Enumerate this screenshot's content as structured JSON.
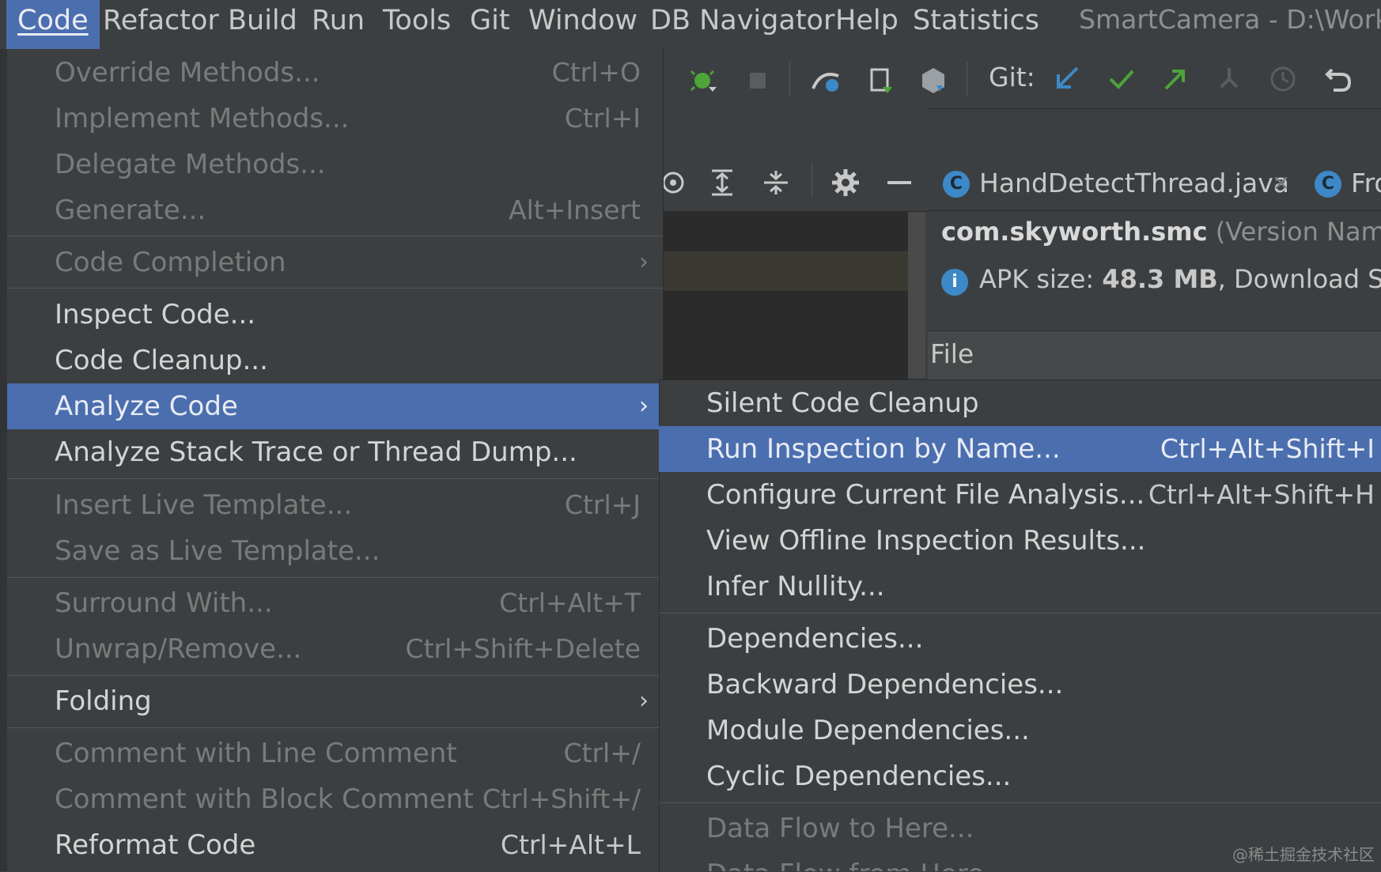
{
  "menubar": {
    "items": [
      "Code",
      "Refactor",
      "Build",
      "Run",
      "Tools",
      "Git",
      "Window",
      "DB Navigator",
      "Help",
      "Statistics"
    ],
    "active": "Code",
    "window_title": "SmartCamera - D:\\Works"
  },
  "toolbar": {
    "git_label": "Git:"
  },
  "editor": {
    "tabs": [
      {
        "icon": "C",
        "label": "HandDetectThread.java",
        "close": "×"
      },
      {
        "icon": "C",
        "label": "Fro"
      }
    ],
    "package_name": "com.skyworth.smc",
    "version_label": "(Version Name:",
    "apk_info_prefix": "APK size:",
    "apk_size": "48.3 MB",
    "apk_info_suffix": ", Download Siz",
    "file_column": "File",
    "info_icon": "i"
  },
  "code_menu": {
    "items": [
      {
        "label": "Override Methods...",
        "shortcut": "Ctrl+O",
        "enabled": false
      },
      {
        "label": "Implement Methods...",
        "shortcut": "Ctrl+I",
        "enabled": false
      },
      {
        "label": "Delegate Methods...",
        "shortcut": "",
        "enabled": false
      },
      {
        "label": "Generate...",
        "shortcut": "Alt+Insert",
        "enabled": false
      },
      {
        "label": "Code Completion",
        "shortcut": "",
        "enabled": false,
        "submenu": true
      },
      {
        "label": "Inspect Code...",
        "shortcut": "",
        "enabled": true
      },
      {
        "label": "Code Cleanup...",
        "shortcut": "",
        "enabled": true
      },
      {
        "label": "Analyze Code",
        "shortcut": "",
        "enabled": true,
        "submenu": true,
        "selected": true
      },
      {
        "label": "Analyze Stack Trace or Thread Dump...",
        "shortcut": "",
        "enabled": true
      },
      {
        "label": "Insert Live Template...",
        "shortcut": "Ctrl+J",
        "enabled": false
      },
      {
        "label": "Save as Live Template...",
        "shortcut": "",
        "enabled": false
      },
      {
        "label": "Surround With...",
        "shortcut": "Ctrl+Alt+T",
        "enabled": false
      },
      {
        "label": "Unwrap/Remove...",
        "shortcut": "Ctrl+Shift+Delete",
        "enabled": false
      },
      {
        "label": "Folding",
        "shortcut": "",
        "enabled": true,
        "submenu": true
      },
      {
        "label": "Comment with Line Comment",
        "shortcut": "Ctrl+/",
        "enabled": false
      },
      {
        "label": "Comment with Block Comment",
        "shortcut": "Ctrl+Shift+/",
        "enabled": false
      },
      {
        "label": "Reformat Code",
        "shortcut": "Ctrl+Alt+L",
        "enabled": true
      }
    ],
    "submenu_arrow": "›"
  },
  "analyze_submenu": {
    "items": [
      {
        "label": "Silent Code Cleanup",
        "shortcut": "",
        "enabled": true
      },
      {
        "label": "Run Inspection by Name...",
        "shortcut": "Ctrl+Alt+Shift+I",
        "enabled": true,
        "selected": true
      },
      {
        "label": "Configure Current File Analysis...",
        "shortcut": "Ctrl+Alt+Shift+H",
        "enabled": true
      },
      {
        "label": "View Offline Inspection Results...",
        "shortcut": "",
        "enabled": true
      },
      {
        "label": "Infer Nullity...",
        "shortcut": "",
        "enabled": true
      },
      {
        "label": "Dependencies...",
        "shortcut": "",
        "enabled": true
      },
      {
        "label": "Backward Dependencies...",
        "shortcut": "",
        "enabled": true
      },
      {
        "label": "Module Dependencies...",
        "shortcut": "",
        "enabled": true
      },
      {
        "label": "Cyclic Dependencies...",
        "shortcut": "",
        "enabled": true
      },
      {
        "label": "Data Flow to Here...",
        "shortcut": "",
        "enabled": false
      },
      {
        "label": "Data Flow from Here...",
        "shortcut": "",
        "enabled": false
      }
    ]
  },
  "watermark": "@稀土掘金技术社区",
  "colors": {
    "selection": "#4b6eaf",
    "menu_bg": "#3c3f41",
    "enabled_text": "#d4d4d4",
    "disabled_text": "#7a7a7a",
    "accent_blue": "#3d89c7",
    "git_green": "#4ca43a"
  }
}
